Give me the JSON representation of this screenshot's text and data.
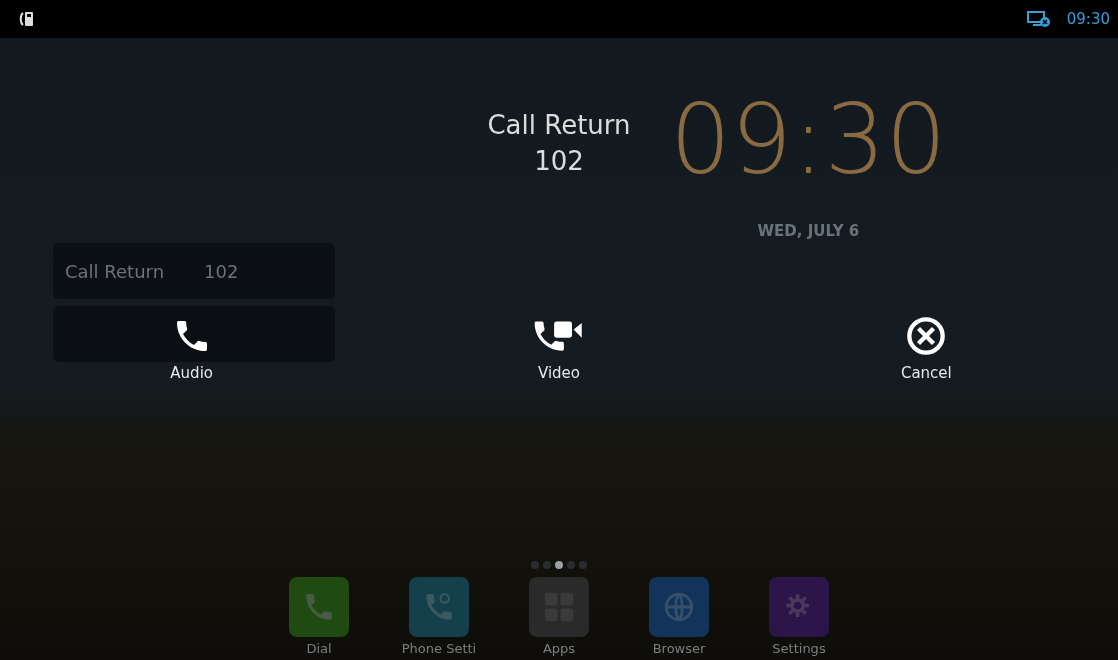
{
  "status_bar": {
    "time": "09:30",
    "network_error": true
  },
  "home": {
    "clock": "09:30",
    "date": "WED, JULY 6",
    "widget": {
      "label": "Call Return",
      "number": "102"
    },
    "page_dots": [
      {
        "selected": false
      },
      {
        "selected": false
      },
      {
        "selected": true
      },
      {
        "selected": false
      },
      {
        "selected": false
      }
    ],
    "dock": [
      {
        "label": "Dial",
        "kind": "dial",
        "color": "#1f4a12"
      },
      {
        "label": "Phone Setti",
        "kind": "phone_settings",
        "color": "#13404a"
      },
      {
        "label": "Apps",
        "kind": "apps",
        "color": "#2a2a2a"
      },
      {
        "label": "Browser",
        "kind": "browser",
        "color": "#12345a"
      },
      {
        "label": "Settings",
        "kind": "settings",
        "color": "#2c1548"
      }
    ]
  },
  "dialog": {
    "title": "Call Return",
    "number": "102",
    "actions": [
      {
        "label": "Audio",
        "kind": "audio"
      },
      {
        "label": "Video",
        "kind": "video"
      },
      {
        "label": "Cancel",
        "kind": "cancel"
      }
    ]
  }
}
